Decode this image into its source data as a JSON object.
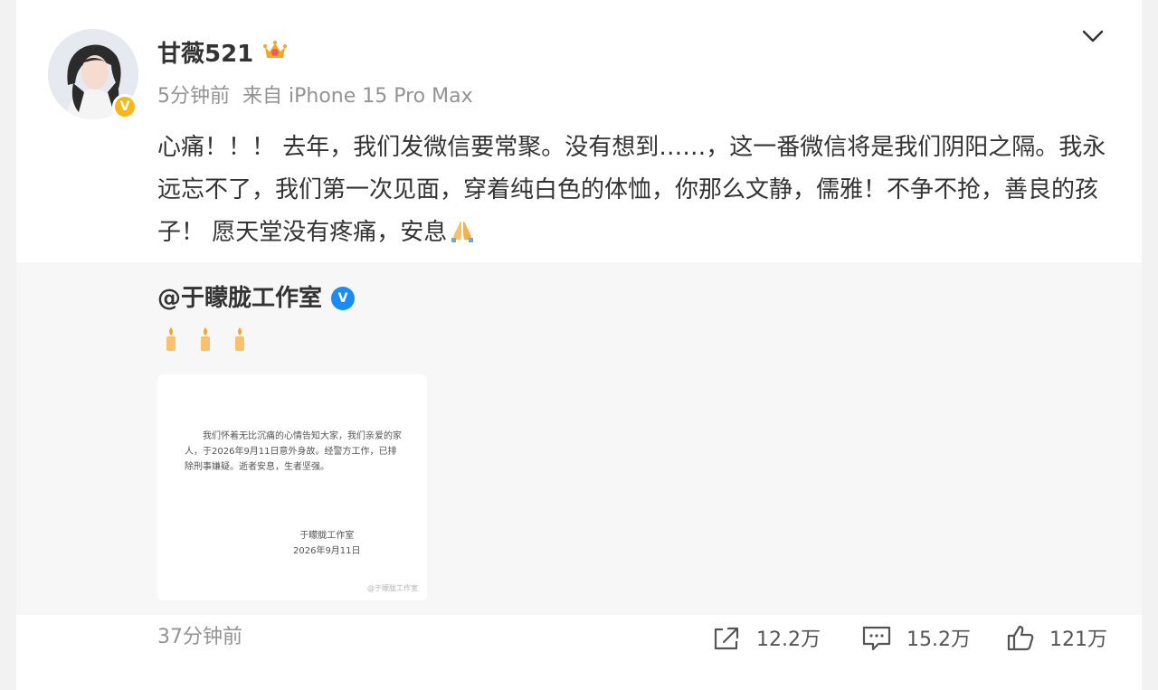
{
  "post": {
    "username": "甘薇521",
    "time": "5分钟前",
    "source": "来自 iPhone 15 Pro Max",
    "text": "心痛！！！ 去年，我们发微信要常聚。没有想到……，这一番微信将是我们阴阳之隔。我永远忘不了，我们第一次见面，穿着纯白色的体恤，你那么文静，儒雅！不争不抢，善良的孩子！ 愿天堂没有疼痛，安息",
    "icons": {
      "member": "crown-icon",
      "verified": "yellow-v-badge",
      "more": "chevron-down-icon",
      "emoji": "praying-hands-icon"
    }
  },
  "repost": {
    "author": "@于矇胧工作室",
    "verified_icon": "blue-v-badge",
    "candles": [
      "candle-icon",
      "candle-icon",
      "candle-icon"
    ],
    "notice": {
      "body": "我们怀着无比沉痛的心情告知大家，我们亲爱的家人，于2026年9月11日意外身故。经警方工作，已排除刑事嫌疑。逝者安息，生者坚强。",
      "signature": "于矇胧工作室",
      "date": "2026年9月11日",
      "watermark": "@于矇胧工作室"
    }
  },
  "footer": {
    "time": "37分钟前",
    "share_count": "12.2万",
    "comment_count": "15.2万",
    "like_count": "121万"
  },
  "colors": {
    "text": "#333333",
    "meta": "#939393",
    "repost_bg": "#f7f7f7",
    "page_bg": "#f2f2f2",
    "verified_yellow": "#f5b719",
    "verified_blue": "#1c8cf5"
  }
}
